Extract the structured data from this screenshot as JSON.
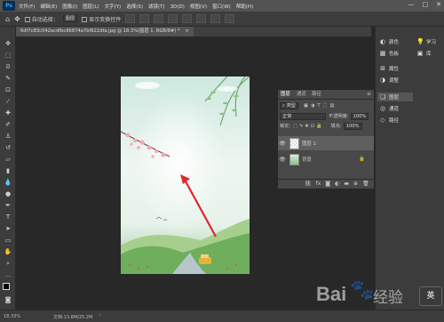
{
  "app": {
    "logo_text": "Ps"
  },
  "menu": [
    "文件(F)",
    "编辑(E)",
    "图像(I)",
    "图层(L)",
    "文字(Y)",
    "选择(S)",
    "滤镜(T)",
    "3D(D)",
    "视图(V)",
    "窗口(W)",
    "帮助(H)"
  ],
  "window_controls": [
    "—",
    "□",
    "✕"
  ],
  "options_bar": {
    "auto_select_label": "自动选择：",
    "auto_select_value": "图层",
    "show_transform_label": "显示变换控件"
  },
  "document_tab": {
    "title": "6df7c83c042acdfbc86874a7bf622dfa.jpg @ 18.3%(图层 1, RGB/8#) *",
    "close": "×"
  },
  "status": {
    "zoom": "18.33%",
    "doc": "文档:13.8M/25.2M",
    "arrow": "›"
  },
  "right_dock": {
    "group1": [
      {
        "icon": "palette-icon",
        "label": "颜色",
        "glyph": "◐"
      },
      {
        "icon": "swatches-icon",
        "label": "色板",
        "glyph": "▦"
      }
    ],
    "group2": [
      {
        "icon": "properties-icon",
        "label": "属性",
        "glyph": "⊞"
      },
      {
        "icon": "adjustments-icon",
        "label": "调整",
        "glyph": "◑"
      }
    ],
    "group3": [
      {
        "icon": "layers-icon",
        "label": "图层",
        "glyph": "❏"
      },
      {
        "icon": "channels-icon",
        "label": "通道",
        "glyph": "◎"
      },
      {
        "icon": "paths-icon",
        "label": "路径",
        "glyph": "◇"
      }
    ],
    "learn": {
      "icon": "lightbulb-icon",
      "label": "学习",
      "glyph": "💡"
    },
    "libraries": {
      "icon": "libraries-icon",
      "label": "库",
      "glyph": "▣"
    }
  },
  "layers_panel": {
    "tabs": [
      "图层",
      "通道",
      "路径"
    ],
    "filter_label": "类型",
    "blend_mode": "正常",
    "opacity_label": "不透明度:",
    "opacity_value": "100%",
    "lock_label": "锁定:",
    "fill_label": "填充:",
    "fill_value": "100%",
    "layers": [
      {
        "name": "图层 1",
        "selected": true
      },
      {
        "name": "背景",
        "selected": false,
        "locked": true
      }
    ],
    "footer_icons": [
      "link-icon",
      "fx-icon",
      "mask-icon",
      "adjustment-layer-icon",
      "group-icon",
      "new-layer-icon",
      "trash-icon"
    ]
  },
  "watermark": {
    "text": "Bai",
    "text2": "经验"
  },
  "ime": {
    "label": "英"
  },
  "colors": {
    "accent": "#31a8ff",
    "arrow": "#e0282a"
  }
}
